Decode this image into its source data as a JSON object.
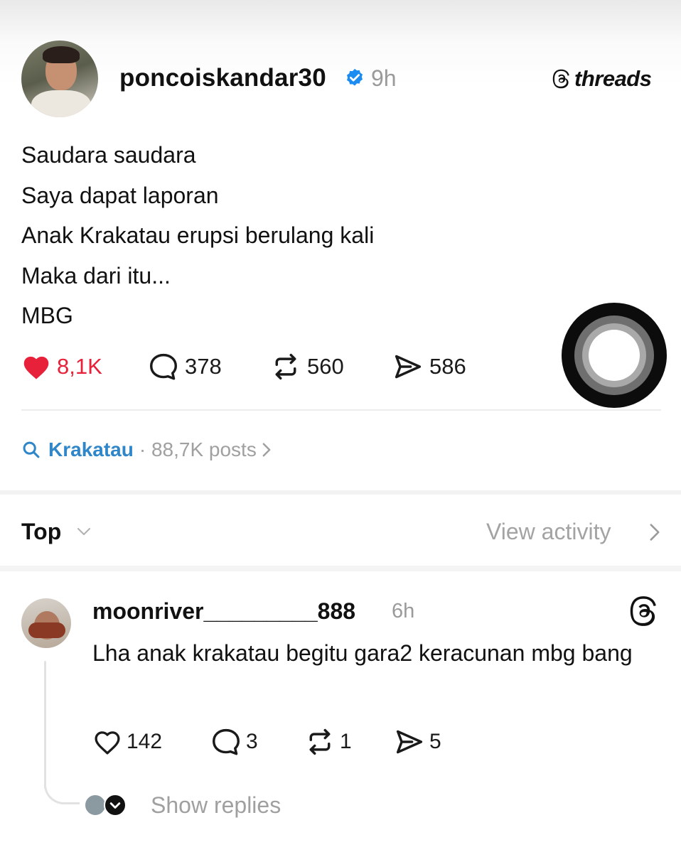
{
  "post": {
    "username": "poncoiskandar30",
    "time": "9h",
    "brand": "threads",
    "lines": [
      "Saudara saudara",
      "Saya dapat laporan",
      "Anak Krakatau erupsi berulang kali",
      "Maka dari itu...",
      "MBG"
    ],
    "likes": "8,1K",
    "comments": "378",
    "reposts": "560",
    "shares": "586",
    "liked": true,
    "like_color": "#e8213a",
    "verified_color": "#1d8cf0"
  },
  "topic": {
    "name": "Krakatau",
    "meta": "· 88,7K posts",
    "color": "#2f86c9"
  },
  "sort": {
    "label": "Top",
    "view_activity": "View activity"
  },
  "reply": {
    "username": "moonriver_________888",
    "time": "6h",
    "text": "Lha anak krakatau begitu gara2 keracunan mbg bang",
    "likes": "142",
    "comments": "3",
    "reposts": "1",
    "shares": "5",
    "show_replies": "Show replies"
  },
  "icons": [
    "heart-icon",
    "comment-icon",
    "repost-icon",
    "share-icon",
    "verified-badge-icon",
    "threads-logo-icon",
    "search-icon",
    "chevron-right-icon",
    "chevron-down-icon"
  ]
}
